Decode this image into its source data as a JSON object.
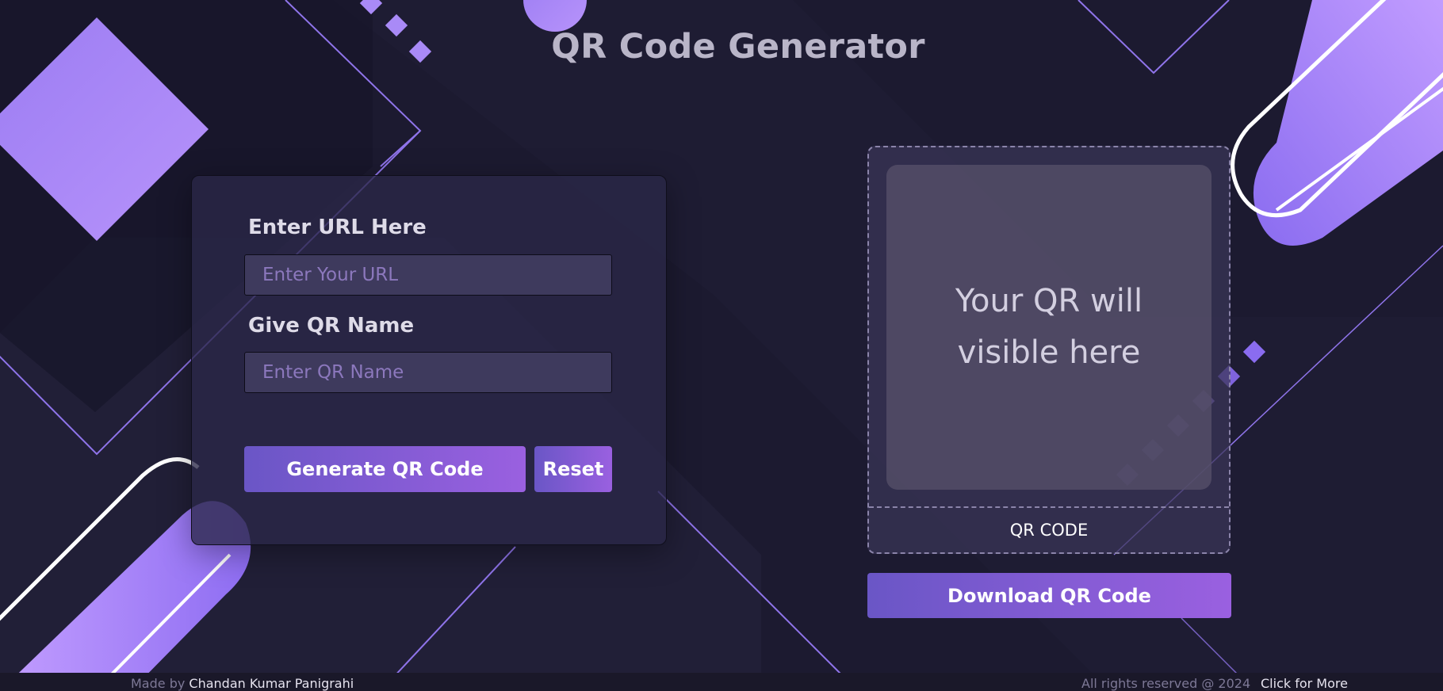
{
  "header": {
    "title": "QR Code Generator"
  },
  "form": {
    "url_label": "Enter URL Here",
    "url_placeholder": "Enter Your URL",
    "url_value": "",
    "name_label": "Give QR Name",
    "name_placeholder": "Enter QR Name",
    "name_value": "",
    "generate_label": "Generate QR Code",
    "reset_label": "Reset"
  },
  "qr": {
    "placeholder": "Your QR will visible here",
    "caption": "QR CODE",
    "download_label": "Download QR Code"
  },
  "footer": {
    "made_by_prefix": "Made by",
    "author": "Chandan Kumar Panigrahi",
    "rights": "All rights reserved @ 2024",
    "more_link": "Click for More"
  },
  "colors": {
    "background": "#1c1a30",
    "accent_start": "#6a56c6",
    "accent_end": "#9a60e0",
    "decor_purple": "#a98af7"
  }
}
